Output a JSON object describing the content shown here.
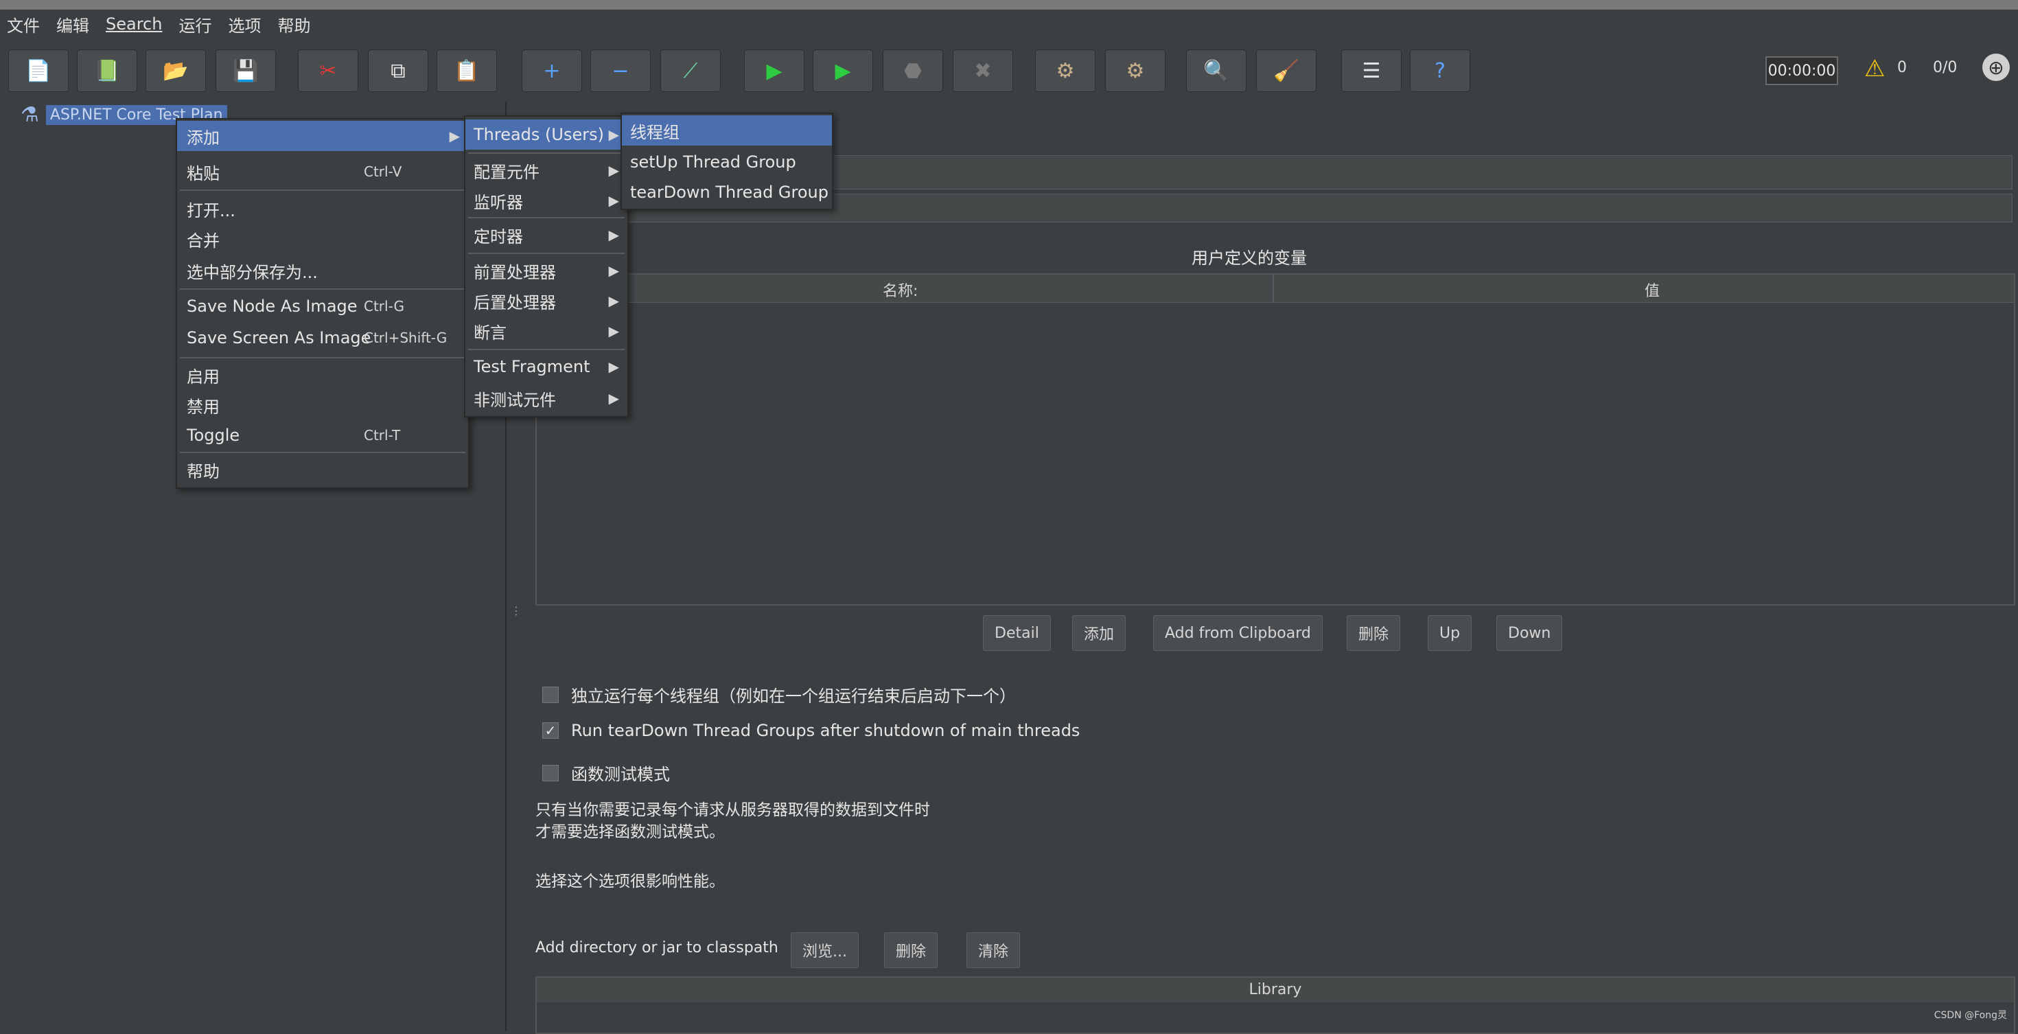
{
  "menubar": [
    "文件",
    "编辑",
    "Search",
    "运行",
    "选项",
    "帮助"
  ],
  "toolbar": {
    "buttons": [
      {
        "name": "new-icon",
        "glyph": "📄",
        "color": "#e6e6e6"
      },
      {
        "name": "templates-icon",
        "glyph": "📗",
        "color": "#4caf50"
      },
      {
        "name": "open-icon",
        "glyph": "📂",
        "color": "#f0b030"
      },
      {
        "name": "save-icon",
        "glyph": "💾",
        "color": "#e6e6e6"
      },
      {
        "name": "cut-icon",
        "glyph": "✂",
        "color": "#e53935"
      },
      {
        "name": "copy-icon",
        "glyph": "⧉",
        "color": "#e6e6e6"
      },
      {
        "name": "paste-icon",
        "glyph": "📋",
        "color": "#e6e6e6"
      },
      {
        "name": "expand-icon",
        "glyph": "+",
        "color": "#5aa0ff"
      },
      {
        "name": "collapse-icon",
        "glyph": "−",
        "color": "#5aa0ff"
      },
      {
        "name": "toggle-icon",
        "glyph": "⟋",
        "color": "#6fd0a0"
      },
      {
        "name": "start-icon",
        "glyph": "▶",
        "color": "#2ecc40"
      },
      {
        "name": "start-no-pause-icon",
        "glyph": "▶",
        "color": "#2ecc40"
      },
      {
        "name": "stop-icon",
        "glyph": "⬣",
        "color": "#7a7a7a"
      },
      {
        "name": "shutdown-icon",
        "glyph": "✖",
        "color": "#7a7a7a"
      },
      {
        "name": "remote-start-icon",
        "glyph": "⚙",
        "color": "#c9b08a"
      },
      {
        "name": "remote-stop-icon",
        "glyph": "⚙",
        "color": "#c9b08a"
      },
      {
        "name": "search-icon",
        "glyph": "🔍",
        "color": "#e6e6e6"
      },
      {
        "name": "clear-icon",
        "glyph": "🧹",
        "color": "#f0c030"
      },
      {
        "name": "function-helper-icon",
        "glyph": "☰",
        "color": "#e6e6e6"
      },
      {
        "name": "help-icon",
        "glyph": "?",
        "color": "#5aa0ff"
      }
    ],
    "timer": "00:00:00",
    "warning_count": "0",
    "thread_ratio": "0/0"
  },
  "tree": {
    "root_label": "ASP.NET Core Test Plan"
  },
  "context_menu": {
    "items": [
      {
        "label": "添加",
        "shortcut": "",
        "submenu": true,
        "selected": true
      },
      {
        "label": "粘贴",
        "shortcut": "Ctrl-V"
      },
      {
        "label": "打开...",
        "shortcut": ""
      },
      {
        "label": "合并",
        "shortcut": ""
      },
      {
        "label": "选中部分保存为...",
        "shortcut": ""
      },
      {
        "label": "Save Node As Image",
        "shortcut": "Ctrl-G"
      },
      {
        "label": "Save Screen As Image",
        "shortcut": "Ctrl+Shift-G"
      },
      {
        "label": "启用",
        "shortcut": ""
      },
      {
        "label": "禁用",
        "shortcut": ""
      },
      {
        "label": "Toggle",
        "shortcut": "Ctrl-T"
      },
      {
        "label": "帮助",
        "shortcut": ""
      }
    ]
  },
  "add_submenu": {
    "items": [
      "Threads (Users)",
      "配置元件",
      "监听器",
      "定时器",
      "前置处理器",
      "后置处理器",
      "断言",
      "Test Fragment",
      "非测试元件"
    ]
  },
  "threads_submenu": {
    "items": [
      "线程组",
      "setUp Thread Group",
      "tearDown Thread Group"
    ]
  },
  "testplan": {
    "udv_title": "用户定义的变量",
    "col_name": "名称:",
    "col_value": "值",
    "buttons": [
      "Detail",
      "添加",
      "Add from Clipboard",
      "删除",
      "Up",
      "Down"
    ],
    "checkboxes": [
      {
        "label": "独立运行每个线程组（例如在一个组运行结束后启动下一个）",
        "checked": false
      },
      {
        "label": "Run tearDown Thread Groups after shutdown of main threads",
        "checked": true
      },
      {
        "label": "函数测试模式",
        "checked": false
      }
    ],
    "note_line1": "只有当你需要记录每个请求从服务器取得的数据到文件时",
    "note_line2": "才需要选择函数测试模式。",
    "note_line3": "选择这个选项很影响性能。",
    "classpath_label": "Add directory or jar to classpath",
    "classpath_buttons": [
      "浏览...",
      "删除",
      "清除"
    ],
    "library_header": "Library"
  },
  "watermark": "CSDN @Fong灵",
  "colors": {
    "selection": "#4b6eaf",
    "background": "#3c3f41"
  }
}
